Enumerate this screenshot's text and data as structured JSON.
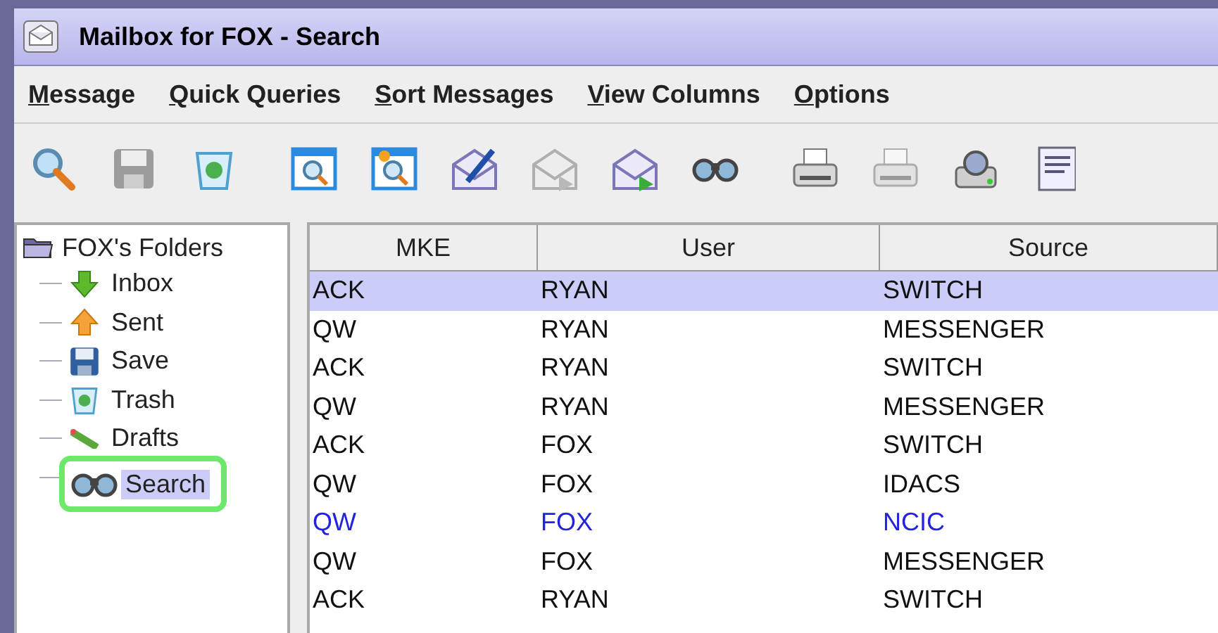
{
  "window": {
    "title": "Mailbox for FOX - Search"
  },
  "menu": [
    {
      "label": "Message"
    },
    {
      "label": "Quick Queries"
    },
    {
      "label": "Sort Messages"
    },
    {
      "label": "View Columns"
    },
    {
      "label": "Options"
    }
  ],
  "toolbar": [
    {
      "kind": "search",
      "disabled": false
    },
    {
      "kind": "save",
      "disabled": true
    },
    {
      "kind": "trash",
      "disabled": false
    },
    {
      "kind": "window-search",
      "disabled": false
    },
    {
      "kind": "window-new-search",
      "disabled": false
    },
    {
      "kind": "compose",
      "disabled": false
    },
    {
      "kind": "reply",
      "disabled": true
    },
    {
      "kind": "forward",
      "disabled": false
    },
    {
      "kind": "binoculars",
      "disabled": false
    },
    {
      "kind": "print",
      "disabled": false
    },
    {
      "kind": "fax",
      "disabled": true
    },
    {
      "kind": "scanner",
      "disabled": false
    },
    {
      "kind": "document",
      "disabled": false
    }
  ],
  "folders": {
    "label": "FOX's Folders",
    "children": [
      {
        "label": "Inbox",
        "kind": "inbox",
        "selected": false
      },
      {
        "label": "Sent",
        "kind": "sent",
        "selected": false
      },
      {
        "label": "Save",
        "kind": "save",
        "selected": false
      },
      {
        "label": "Trash",
        "kind": "trash",
        "selected": false
      },
      {
        "label": "Drafts",
        "kind": "drafts",
        "selected": false
      },
      {
        "label": "Search",
        "kind": "search",
        "selected": true
      }
    ]
  },
  "table": {
    "columns": [
      "MKE",
      "User",
      "Source"
    ],
    "rows": [
      {
        "cells": [
          "ACK",
          "RYAN",
          "SWITCH"
        ],
        "selected": true,
        "new": false
      },
      {
        "cells": [
          "QW",
          "RYAN",
          "MESSENGER"
        ],
        "selected": false,
        "new": false
      },
      {
        "cells": [
          "ACK",
          "RYAN",
          "SWITCH"
        ],
        "selected": false,
        "new": false
      },
      {
        "cells": [
          "QW",
          "RYAN",
          "MESSENGER"
        ],
        "selected": false,
        "new": false
      },
      {
        "cells": [
          "ACK",
          "FOX",
          "SWITCH"
        ],
        "selected": false,
        "new": false
      },
      {
        "cells": [
          "QW",
          "FOX",
          "IDACS"
        ],
        "selected": false,
        "new": false
      },
      {
        "cells": [
          "QW",
          "FOX",
          "NCIC"
        ],
        "selected": false,
        "new": true
      },
      {
        "cells": [
          "QW",
          "FOX",
          "MESSENGER"
        ],
        "selected": false,
        "new": false
      },
      {
        "cells": [
          "ACK",
          "RYAN",
          "SWITCH"
        ],
        "selected": false,
        "new": false
      }
    ]
  }
}
